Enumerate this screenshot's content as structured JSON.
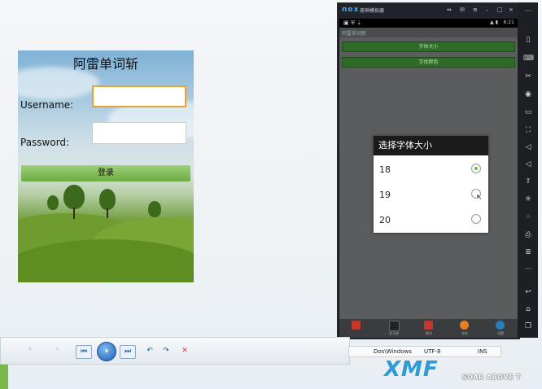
{
  "login_app": {
    "title": "阿雷单词斩",
    "username_label": "Username:",
    "password_label": "Password:",
    "login_button": "登录"
  },
  "emulator": {
    "logo": "nox",
    "title": "夜神模拟器",
    "window_controls": [
      "⇔",
      "✉",
      "≡",
      "–",
      "□",
      "×"
    ],
    "status_time": "6:21",
    "app_name": "阿雷单词斩",
    "buttons": [
      "字体大小",
      "字体颜色"
    ],
    "dialog": {
      "title": "选择字体大小",
      "options": [
        {
          "label": "18",
          "selected": true
        },
        {
          "label": "19",
          "selected": false
        },
        {
          "label": "20",
          "selected": false
        }
      ]
    },
    "dock_apps": [
      {
        "label": "",
        "color": "#c0392b",
        "icon": "pdf-icon"
      },
      {
        "label": "亚马逊",
        "color": "#222222",
        "icon": "amazon-icon"
      },
      {
        "label": "图书",
        "color": "#c0392b",
        "icon": "books-icon"
      },
      {
        "label": "浏览",
        "color": "#e67e22",
        "icon": "browser-icon"
      },
      {
        "label": "设置",
        "color": "#2980b9",
        "icon": "globe-icon"
      }
    ],
    "sidebar_icons": [
      "phone-icon",
      "keyboard-icon",
      "scissors-icon",
      "location-icon",
      "screen-icon",
      "fullscreen-icon",
      "volume-up-icon",
      "volume-down-icon",
      "install-icon",
      "loading-icon",
      "shake-icon",
      "printer-icon",
      "multi-icon",
      "more-icon",
      "back-icon",
      "home-icon",
      "recent-icon"
    ]
  },
  "player": {
    "controls": [
      "⏮",
      "⏸",
      "⏭",
      "↶",
      "↷",
      "✕"
    ]
  },
  "editor_status": {
    "line_ending": "Dos\\Windows",
    "encoding": "UTF-8",
    "mode": "INS"
  },
  "brand": {
    "logo": "XMF",
    "tagline": "SOAR ABOVE T"
  }
}
